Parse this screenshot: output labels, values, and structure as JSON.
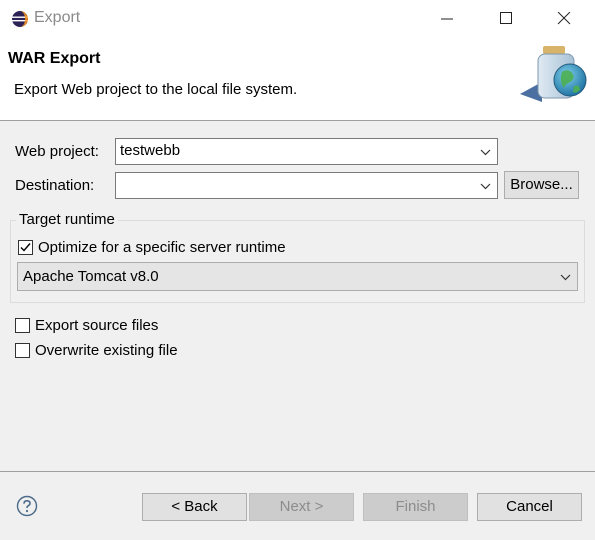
{
  "window": {
    "title": "Export",
    "icon": "eclipse-icon"
  },
  "header": {
    "title": "WAR Export",
    "description": "Export Web project to the local file system.",
    "image": "jar-globe-icon"
  },
  "form": {
    "web_project_label": "Web project:",
    "web_project_value": "testwebb",
    "destination_label": "Destination:",
    "destination_value": "",
    "browse_label": "Browse..."
  },
  "target_runtime": {
    "group_title": "Target runtime",
    "optimize_label": "Optimize for a specific server runtime",
    "optimize_checked": true,
    "runtime_value": "Apache Tomcat v8.0"
  },
  "options": {
    "export_source_label": "Export source files",
    "export_source_checked": false,
    "overwrite_label": "Overwrite existing file",
    "overwrite_checked": false
  },
  "footer": {
    "back_label": "< Back",
    "next_label": "Next >",
    "finish_label": "Finish",
    "cancel_label": "Cancel",
    "help_icon": "help-icon"
  }
}
